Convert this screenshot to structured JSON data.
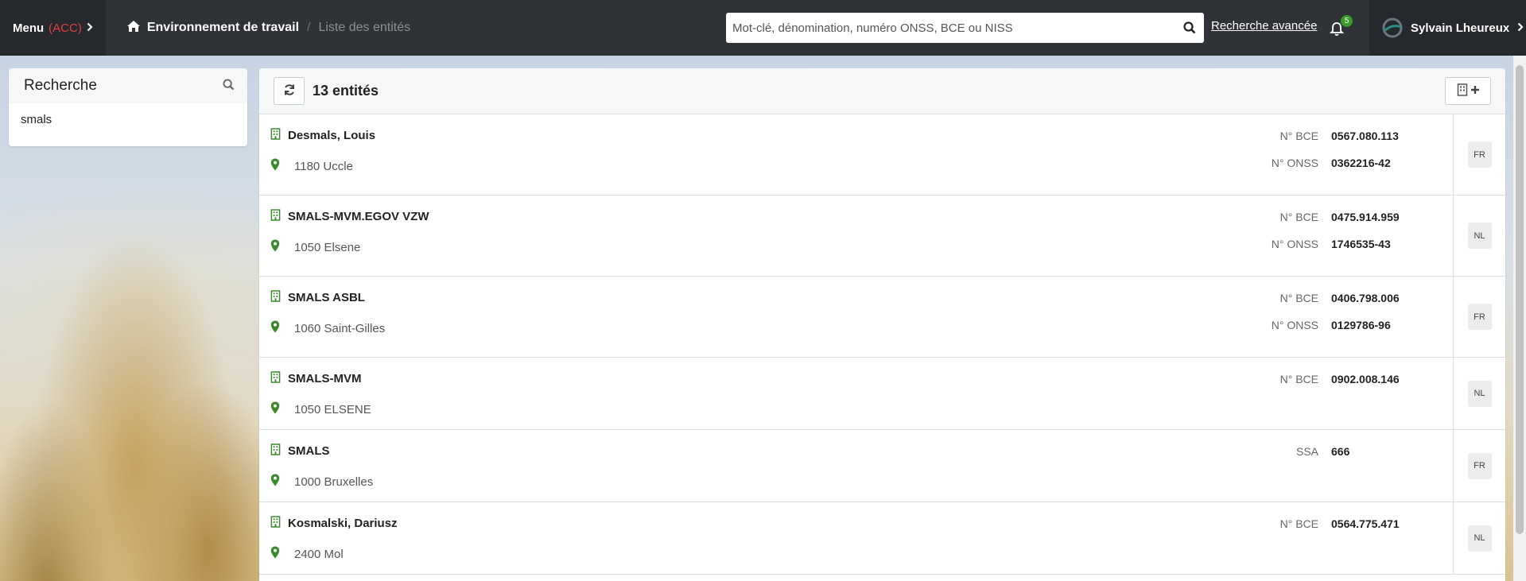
{
  "topbar": {
    "menu_label": "Menu",
    "menu_env": "(ACC)",
    "breadcrumb": {
      "home": "Environnement de travail",
      "current": "Liste des entités"
    },
    "search_placeholder": "Mot-clé, dénomination, numéro ONSS, BCE ou NISS",
    "advanced_search": "Recherche avancée",
    "notifications_count": "5",
    "user_name": "Sylvain Lheureux"
  },
  "sidebar": {
    "title": "Recherche",
    "term": "smals"
  },
  "main": {
    "count_label": "13 entités",
    "rows": [
      {
        "name": "Desmals, Louis",
        "address": "1180 Uccle",
        "ids": [
          {
            "label": "N° BCE",
            "value": "0567.080.113"
          },
          {
            "label": "N° ONSS",
            "value": "0362216-42"
          }
        ],
        "lang": "FR"
      },
      {
        "name": "SMALS-MVM.EGOV VZW",
        "address": "1050 Elsene",
        "ids": [
          {
            "label": "N° BCE",
            "value": "0475.914.959"
          },
          {
            "label": "N° ONSS",
            "value": "1746535-43"
          }
        ],
        "lang": "NL"
      },
      {
        "name": "SMALS ASBL",
        "address": "1060 Saint-Gilles",
        "ids": [
          {
            "label": "N° BCE",
            "value": "0406.798.006"
          },
          {
            "label": "N° ONSS",
            "value": "0129786-96"
          }
        ],
        "lang": "FR"
      },
      {
        "name": "SMALS-MVM",
        "address": "1050 ELSENE",
        "ids": [
          {
            "label": "N° BCE",
            "value": "0902.008.146"
          }
        ],
        "lang": "NL"
      },
      {
        "name": "SMALS",
        "address": "1000 Bruxelles",
        "ids": [
          {
            "label": "SSA",
            "value": "666"
          }
        ],
        "lang": "FR"
      },
      {
        "name": "Kosmalski, Dariusz",
        "address": "2400 Mol",
        "ids": [
          {
            "label": "N° BCE",
            "value": "0564.775.471"
          }
        ],
        "lang": "NL"
      }
    ]
  },
  "colors": {
    "topbar": "#2f3338",
    "accent_green": "#3a8a2c",
    "env_red": "#e04040"
  }
}
